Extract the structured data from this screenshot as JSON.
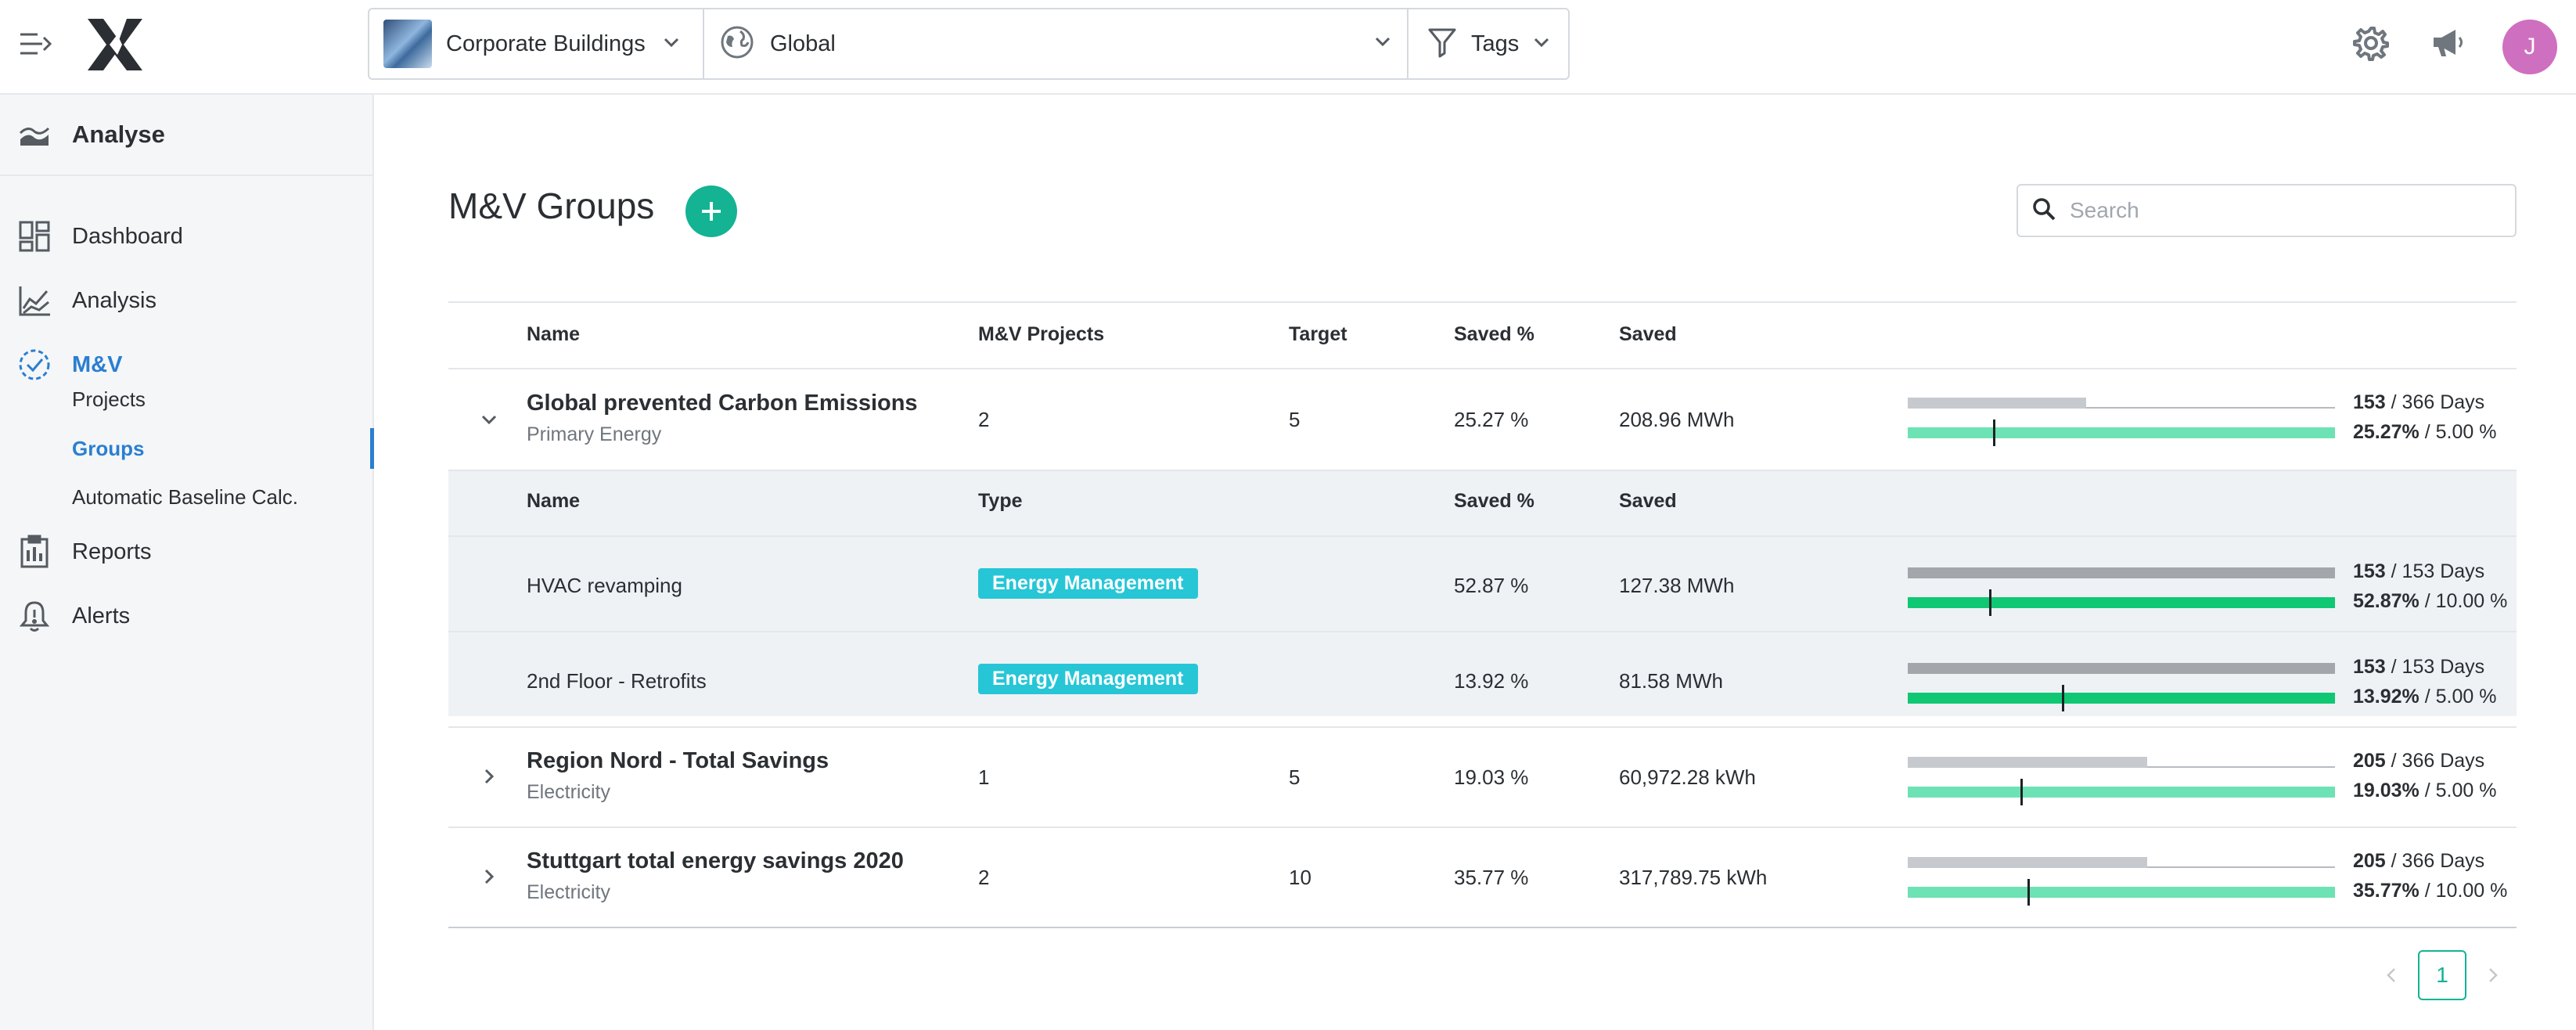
{
  "topbar": {
    "site_selector": "Corporate Buildings",
    "scope_selector": "Global",
    "tags_selector": "Tags",
    "avatar_initial": "J"
  },
  "sidebar": {
    "section": "Analyse",
    "items": [
      {
        "label": "Dashboard",
        "icon": "dashboard-icon"
      },
      {
        "label": "Analysis",
        "icon": "chart-line-icon"
      },
      {
        "label": "M&V",
        "icon": "check-circle-icon",
        "active": true
      },
      {
        "label": "Reports",
        "icon": "clipboard-icon"
      },
      {
        "label": "Alerts",
        "icon": "bell-icon"
      }
    ],
    "subitems": [
      {
        "label": "Projects"
      },
      {
        "label": "Groups",
        "active": true
      },
      {
        "label": "Automatic Baseline Calc."
      }
    ]
  },
  "main": {
    "title": "M&V Groups",
    "search_placeholder": "Search",
    "columns": {
      "name": "Name",
      "projects": "M&V Projects",
      "target": "Target",
      "saved_pct": "Saved %",
      "saved": "Saved"
    },
    "sub_columns": {
      "name": "Name",
      "type": "Type",
      "saved_pct": "Saved %",
      "saved": "Saved"
    },
    "groups": [
      {
        "name": "Global prevented Carbon Emissions",
        "subtitle": "Primary Energy",
        "projects": "2",
        "target": "5",
        "saved_pct": "25.27 %",
        "saved": "208.96 MWh",
        "expanded": true,
        "days_progress": 0.418,
        "days_done": "153",
        "days_text": " / 366 Days",
        "savings_progress": 0.2,
        "savings_pct": "25.27%",
        "savings_target": " / 5.00 %"
      },
      {
        "name": "Region Nord - Total Savings",
        "subtitle": "Electricity",
        "projects": "1",
        "target": "5",
        "saved_pct": "19.03 %",
        "saved": "60,972.28 kWh",
        "expanded": false,
        "days_progress": 0.56,
        "days_done": "205",
        "days_text": " / 366 Days",
        "savings_progress": 0.263,
        "savings_pct": "19.03%",
        "savings_target": " / 5.00 %"
      },
      {
        "name": "Stuttgart total energy savings 2020",
        "subtitle": "Electricity",
        "projects": "2",
        "target": "10",
        "saved_pct": "35.77 %",
        "saved": "317,789.75 kWh",
        "expanded": false,
        "days_progress": 0.56,
        "days_done": "205",
        "days_text": " / 366 Days",
        "savings_progress": 0.28,
        "savings_pct": "35.77%",
        "savings_target": " / 10.00 %"
      }
    ],
    "projects": [
      {
        "name": "HVAC revamping",
        "type": "Energy Management",
        "saved_pct": "52.87 %",
        "saved": "127.38 MWh",
        "days_progress": 1.0,
        "days_done": "153",
        "days_text": " / 153 Days",
        "savings_progress": 0.19,
        "savings_pct": "52.87%",
        "savings_target": " / 10.00 %"
      },
      {
        "name": "2nd Floor - Retrofits",
        "type": "Energy Management",
        "saved_pct": "13.92 %",
        "saved": "81.58 MWh",
        "days_progress": 1.0,
        "days_done": "153",
        "days_text": " / 153 Days",
        "savings_progress": 0.36,
        "savings_pct": "13.92%",
        "savings_target": " / 5.00 %"
      }
    ]
  },
  "pagination": {
    "current": "1"
  },
  "colors": {
    "accent": "#13b394",
    "active_nav": "#2a7fd0",
    "badge": "#26c6d6",
    "savings_bar": "#6de2b4",
    "project_savings_bar": "#10c873",
    "avatar": "#cf6fc0"
  }
}
